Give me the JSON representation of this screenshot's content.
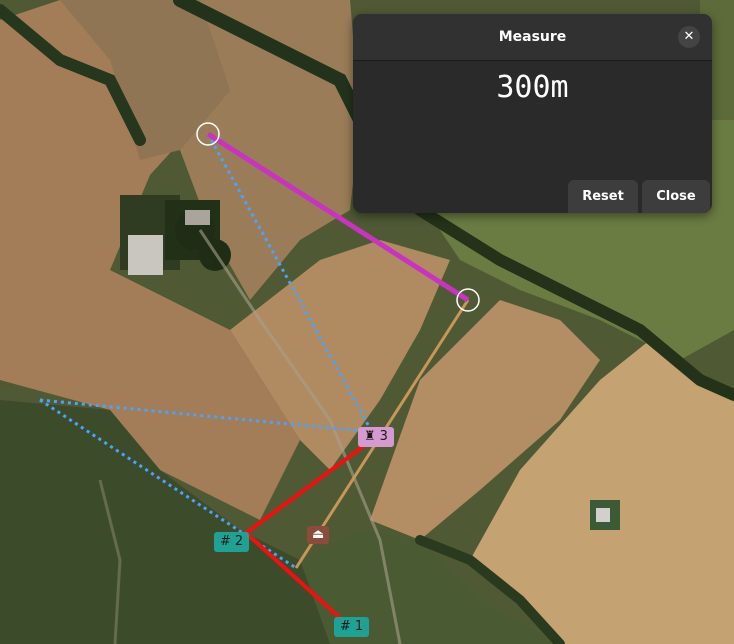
{
  "map": {
    "markers": [
      {
        "id": "1",
        "symbol": "#",
        "label": "1",
        "color": "#1fa294"
      },
      {
        "id": "2",
        "symbol": "#",
        "label": "2",
        "color": "#1fa294"
      },
      {
        "id": "3",
        "symbol": "♜",
        "label": "3",
        "color": "#d59ad0"
      },
      {
        "id": "hut",
        "symbol": "⏏",
        "label": "",
        "color": "#8a4d3c"
      }
    ],
    "line_colors": {
      "measure": "#c833c0",
      "route": "#ee1111",
      "track": "#c8955a",
      "dotted": "#4aa3ff"
    }
  },
  "measure_dialog": {
    "title": "Measure",
    "close_icon": "✕",
    "distance": "300m",
    "reset_label": "Reset",
    "close_label": "Close"
  }
}
